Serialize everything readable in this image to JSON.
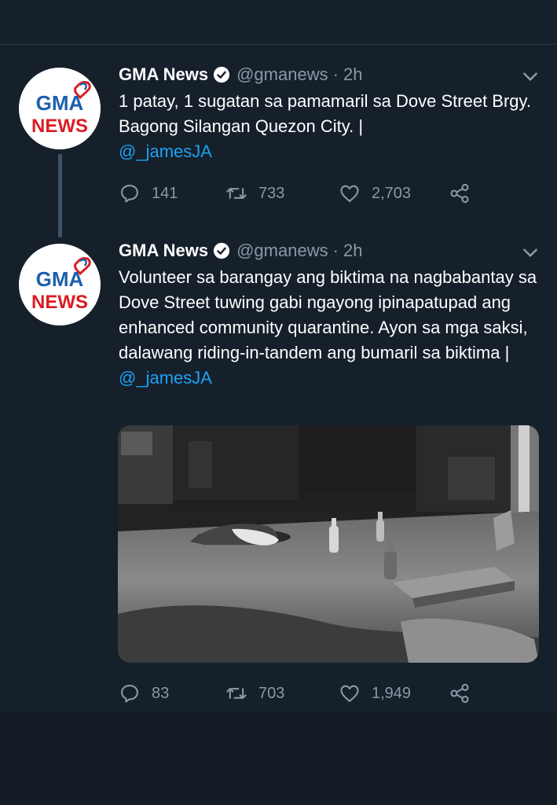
{
  "tweets": [
    {
      "name": "GMA News",
      "handle": "@gmanews",
      "time": "· 2h",
      "text": "1 patay, 1 sugatan sa pamamaril sa Dove Street Brgy. Bagong Silangan Quezon City. |",
      "mention": "@_jamesJA",
      "replies": "141",
      "retweets": "733",
      "likes": "2,703"
    },
    {
      "name": "GMA News",
      "handle": "@gmanews",
      "time": "· 2h",
      "text": "Volunteer sa barangay ang biktima na nagbabantay sa Dove Street tuwing gabi ngayong ipinapatupad ang enhanced community quarantine. Ayon sa mga saksi, dalawang riding-in-tandem ang bumaril sa biktima |",
      "mention": "@_jamesJA",
      "replies": "83",
      "retweets": "703",
      "likes": "1,949"
    }
  ],
  "avatar": {
    "line1": "GMA",
    "line2": "NEWS"
  },
  "icons": {
    "verified": "verified-badge-icon",
    "menu": "chevron-down-icon",
    "reply": "reply-icon",
    "retweet": "retweet-icon",
    "like": "heart-icon",
    "share": "share-icon"
  },
  "colors": {
    "background": "#15202b",
    "secondary_text": "#8899a6",
    "link": "#1da1f2",
    "gma_blue": "#1e5faa",
    "gma_red": "#d91c24"
  }
}
